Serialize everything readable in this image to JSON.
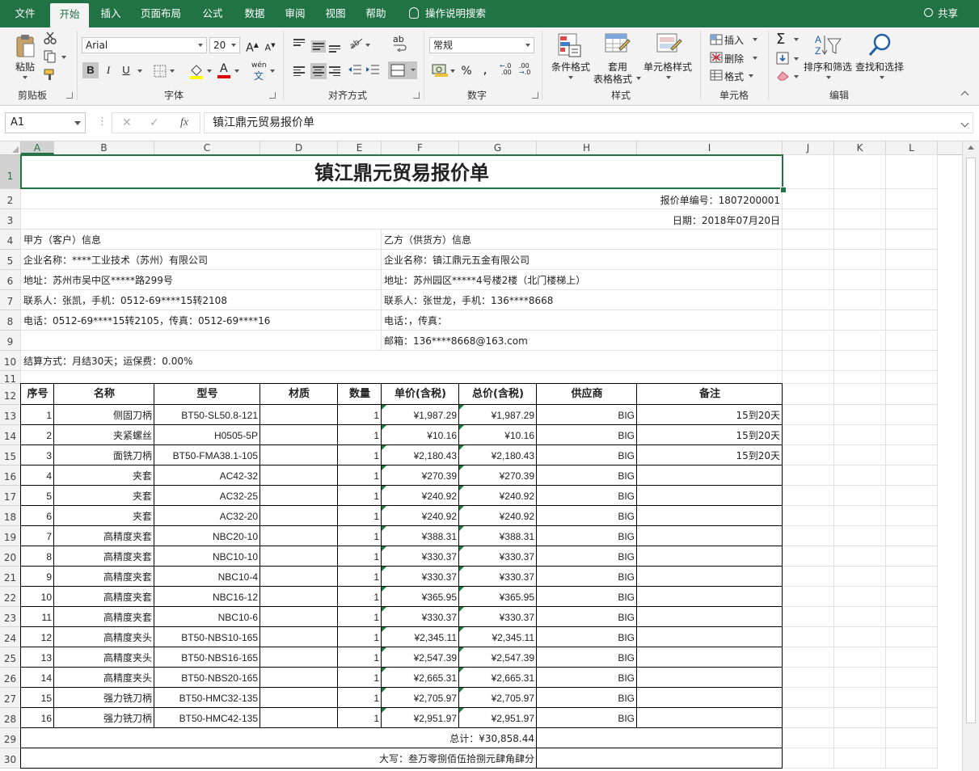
{
  "tabs": [
    "文件",
    "开始",
    "插入",
    "页面布局",
    "公式",
    "数据",
    "审阅",
    "视图",
    "帮助"
  ],
  "tell_me": "操作说明搜索",
  "share": "共享",
  "ribbon": {
    "paste_label": "粘贴",
    "groups": [
      "剪贴板",
      "字体",
      "对齐方式",
      "数字",
      "样式",
      "单元格",
      "编辑"
    ],
    "font_name": "Arial",
    "font_size": "20",
    "number_format": "常规",
    "conditional_format": "条件格式",
    "table_format_1": "套用",
    "table_format_2": "表格格式",
    "cell_style": "单元格样式",
    "insert": "插入",
    "delete": "删除",
    "format": "格式",
    "sort_filter": "排序和筛选",
    "find_select": "查找和选择",
    "bold": "B",
    "italic": "I",
    "underline": "U",
    "font_grow": "A",
    "font_shrink": "A",
    "font_color_letter": "A",
    "wen": "wén",
    "ab": "ab",
    "percent": "%",
    "comma": ",",
    "dec_inc": ".00",
    "dec_dec": ".0"
  },
  "formula_bar": {
    "name_box": "A1",
    "content": "镇江鼎元贸易报价单"
  },
  "columns": [
    "A",
    "B",
    "C",
    "D",
    "E",
    "F",
    "G",
    "H",
    "I",
    "J",
    "K",
    "L"
  ],
  "rows": [
    "1",
    "2",
    "3",
    "4",
    "5",
    "6",
    "7",
    "8",
    "9",
    "10",
    "11",
    "12",
    "13",
    "14",
    "15",
    "16",
    "17",
    "18",
    "19",
    "20",
    "21",
    "22",
    "23",
    "24",
    "25",
    "26",
    "27",
    "28",
    "29",
    "30"
  ],
  "sheet": {
    "title": "镇江鼎元贸易报价单",
    "quote_no": "报价单编号：1807200001",
    "date": "日期：2018年07月20日",
    "party_a": {
      "header": "甲方（客户）信息",
      "company": "企业名称：****工业技术（苏州）有限公司",
      "address": "地址：苏州市吴中区*****路299号",
      "contact": "联系人：张凯，手机：0512-69****15转2108",
      "phone": "电话：0512-69****15转2105，传真：0512-69****16"
    },
    "party_b": {
      "header": "乙方（供货方）信息",
      "company": "企业名称：镇江鼎元五金有限公司",
      "address": "地址：苏州园区*****4号楼2楼（北门楼梯上）",
      "contact": "联系人：张世龙，手机：136****8668",
      "phone": "电话：，传真：",
      "email": "邮箱：136****8668@163.com"
    },
    "settlement": "结算方式：月结30天；运保费：0.00%",
    "headers": [
      "序号",
      "名称",
      "型号",
      "材质",
      "数量",
      "单价(含税)",
      "总价(含税)",
      "供应商",
      "备注"
    ],
    "items": [
      [
        "1",
        "侧固刀柄",
        "BT50-SL50.8-121",
        "",
        "1",
        "¥1,987.29",
        "¥1,987.29",
        "BIG",
        "15到20天"
      ],
      [
        "2",
        "夹紧螺丝",
        "H0505-5P",
        "",
        "1",
        "¥10.16",
        "¥10.16",
        "BIG",
        "15到20天"
      ],
      [
        "3",
        "面铣刀柄",
        "BT50-FMA38.1-105",
        "",
        "1",
        "¥2,180.43",
        "¥2,180.43",
        "BIG",
        "15到20天"
      ],
      [
        "4",
        "夹套",
        "AC42-32",
        "",
        "1",
        "¥270.39",
        "¥270.39",
        "BIG",
        ""
      ],
      [
        "5",
        "夹套",
        "AC32-25",
        "",
        "1",
        "¥240.92",
        "¥240.92",
        "BIG",
        ""
      ],
      [
        "6",
        "夹套",
        "AC32-20",
        "",
        "1",
        "¥240.92",
        "¥240.92",
        "BIG",
        ""
      ],
      [
        "7",
        "高精度夹套",
        "NBC20-10",
        "",
        "1",
        "¥388.31",
        "¥388.31",
        "BIG",
        ""
      ],
      [
        "8",
        "高精度夹套",
        "NBC10-10",
        "",
        "1",
        "¥330.37",
        "¥330.37",
        "BIG",
        ""
      ],
      [
        "9",
        "高精度夹套",
        "NBC10-4",
        "",
        "1",
        "¥330.37",
        "¥330.37",
        "BIG",
        ""
      ],
      [
        "10",
        "高精度夹套",
        "NBC16-12",
        "",
        "1",
        "¥365.95",
        "¥365.95",
        "BIG",
        ""
      ],
      [
        "11",
        "高精度夹套",
        "NBC10-6",
        "",
        "1",
        "¥330.37",
        "¥330.37",
        "BIG",
        ""
      ],
      [
        "12",
        "高精度夹头",
        "BT50-NBS10-165",
        "",
        "1",
        "¥2,345.11",
        "¥2,345.11",
        "BIG",
        ""
      ],
      [
        "13",
        "高精度夹头",
        "BT50-NBS16-165",
        "",
        "1",
        "¥2,547.39",
        "¥2,547.39",
        "BIG",
        ""
      ],
      [
        "14",
        "高精度夹头",
        "BT50-NBS20-165",
        "",
        "1",
        "¥2,665.31",
        "¥2,665.31",
        "BIG",
        ""
      ],
      [
        "15",
        "强力铣刀柄",
        "BT50-HMC32-135",
        "",
        "1",
        "¥2,705.97",
        "¥2,705.97",
        "BIG",
        ""
      ],
      [
        "16",
        "强力铣刀柄",
        "BT50-HMC42-135",
        "",
        "1",
        "¥2,951.97",
        "¥2,951.97",
        "BIG",
        ""
      ]
    ],
    "total": "总计：¥30,858.44",
    "total_words": "大写：叁万零捌佰伍拾捌元肆角肆分"
  }
}
